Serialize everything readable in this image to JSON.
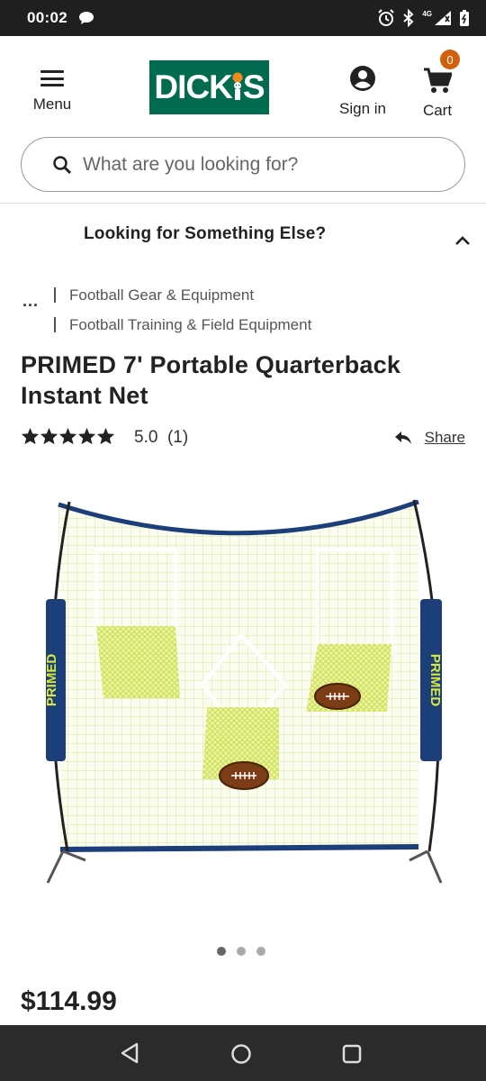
{
  "status_bar": {
    "time": "00:02",
    "network_label": "4G"
  },
  "header": {
    "menu_label": "Menu",
    "logo_text_left": "DICK",
    "logo_text_right": "S",
    "signin_label": "Sign in",
    "cart_label": "Cart",
    "cart_count": "0",
    "brand_color": "#006b4e",
    "badge_color": "#d2600b"
  },
  "search": {
    "placeholder": "What are you looking for?"
  },
  "accordion": {
    "title": "Looking for Something Else?"
  },
  "breadcrumb": {
    "ellipsis": "...",
    "items": [
      "Football Gear & Equipment",
      "Football Training & Field Equipment"
    ]
  },
  "product": {
    "title": "PRIMED 7' Portable Quarterback Instant Net",
    "rating": 5.0,
    "rating_text": "5.0",
    "review_count_text": "(1)",
    "share_label": "Share",
    "image_brand_text": "PRIMED",
    "price": "$114.99",
    "gallery": {
      "total": 3,
      "active_index": 0
    }
  }
}
